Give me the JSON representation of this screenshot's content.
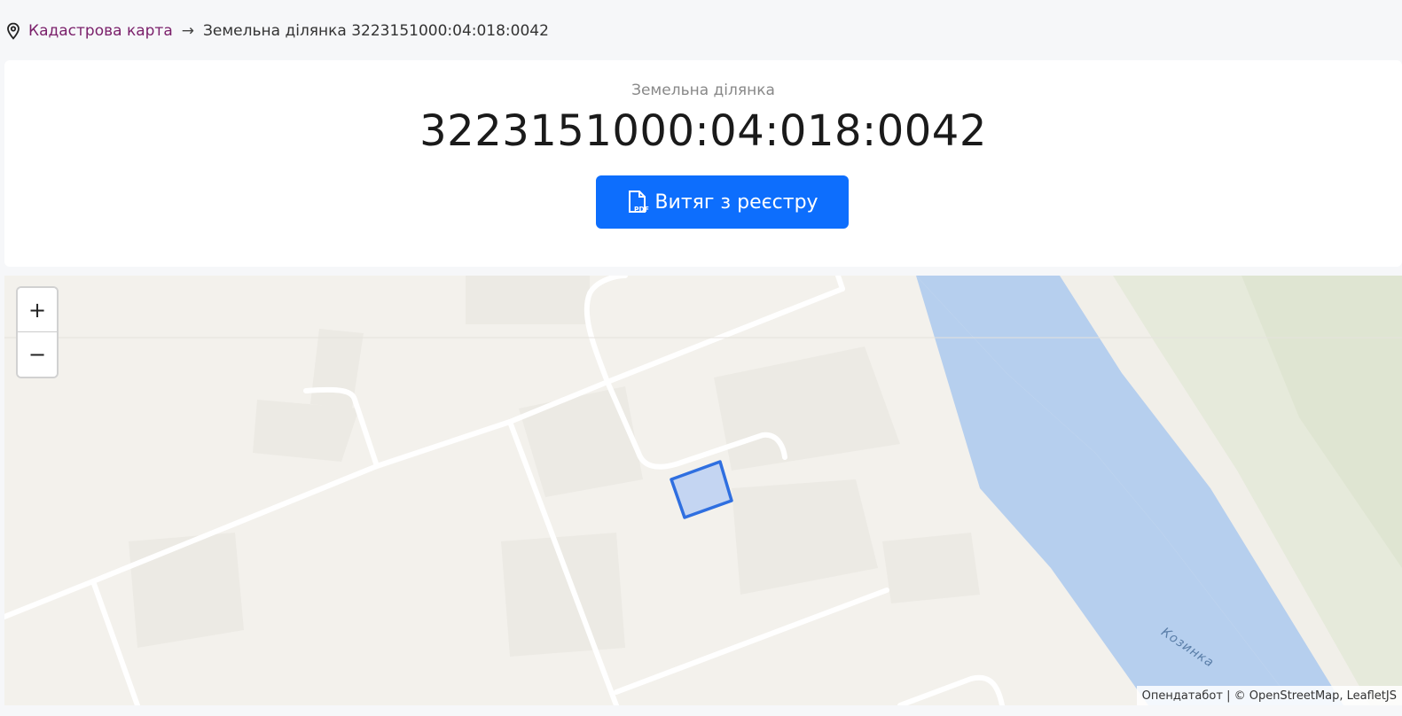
{
  "breadcrumb": {
    "root_label": "Кадастрова карта",
    "separator": "→",
    "current_label": "Земельна ділянка 3223151000:04:018:0042"
  },
  "parcel": {
    "subtitle": "Земельна ділянка",
    "cadastral_number": "3223151000:04:018:0042"
  },
  "actions": {
    "extract_label": "Витяг з реєстру",
    "extract_icon": "pdf-file-icon"
  },
  "map": {
    "zoom_in_label": "+",
    "zoom_out_label": "−",
    "attribution": "Опендатабот | © OpenStreetMap, LeafletJS",
    "river_label": "Козинка",
    "colors": {
      "land": "#f3f1ec",
      "road": "#ffffff",
      "water": "#b6cfee",
      "green": "#e6eadb",
      "parcel_fill": "#c4d5f2",
      "parcel_stroke": "#2f6fe0"
    }
  },
  "colors": {
    "accent": "#0d6efd",
    "breadcrumb_link": "#7a1f6a"
  }
}
